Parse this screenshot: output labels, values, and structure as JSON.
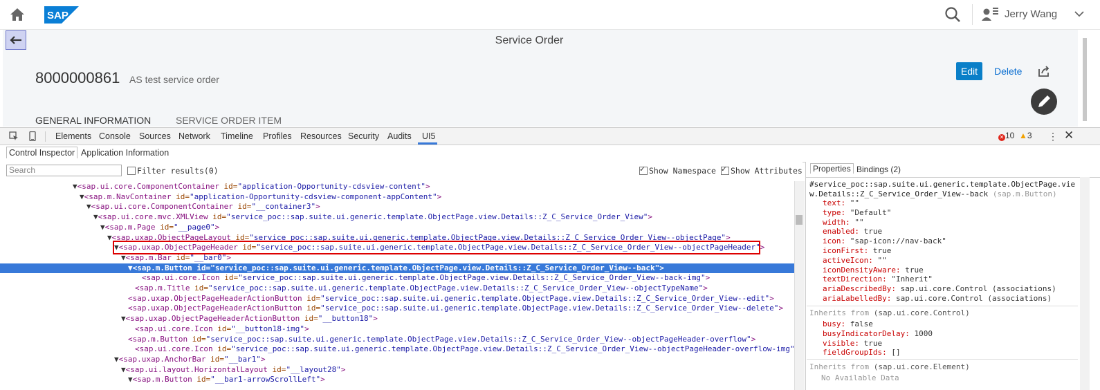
{
  "shell": {
    "user_name": "Jerry Wang",
    "logo_text": "SAP"
  },
  "page": {
    "title": "Service Order",
    "object_id": "8000000861",
    "object_description": "AS test service order",
    "edit_label": "Edit",
    "delete_label": "Delete",
    "tabs": [
      "GENERAL INFORMATION",
      "SERVICE ORDER ITEM"
    ]
  },
  "devtools": {
    "tabs": [
      "Elements",
      "Console",
      "Sources",
      "Network",
      "Timeline",
      "Profiles",
      "Resources",
      "Security",
      "Audits",
      "UI5"
    ],
    "errors": "10",
    "warnings": "3",
    "sub_tabs": [
      "Control Inspector",
      "Application Information"
    ],
    "search_placeholder": "Search",
    "filter_label": "Filter results(0)",
    "show_namespace": "Show Namespace",
    "show_attributes": "Show Attributes"
  },
  "tree": [
    {
      "indent": 105,
      "tri": "▼",
      "tag": "<sap.ui.core.ComponentContainer",
      "attr": " id=",
      "val": "\"application-Opportunity-cdsview-content\"",
      "end": ">"
    },
    {
      "indent": 115,
      "tri": "▼",
      "tag": "<sap.m.NavContainer",
      "attr": " id=",
      "val": "\"application-Opportunity-cdsview-component-appContent\"",
      "end": ">"
    },
    {
      "indent": 125,
      "tri": "▼",
      "tag": "<sap.ui.core.ComponentContainer",
      "attr": " id=",
      "val": "\"__container3\"",
      "end": ">"
    },
    {
      "indent": 135,
      "tri": "▼",
      "tag": "<sap.ui.core.mvc.XMLView",
      "attr": " id=",
      "val": "\"service_poc::sap.suite.ui.generic.template.ObjectPage.view.Details::Z_C_Service_Order_View\"",
      "end": ">"
    },
    {
      "indent": 145,
      "tri": "▼",
      "tag": "<sap.m.Page",
      "attr": " id=",
      "val": "\"__page0\"",
      "end": ">"
    },
    {
      "indent": 155,
      "tri": "▼",
      "tag": "<sap.uxap.ObjectPageLayout",
      "attr": " id=",
      "val": "\"service_poc::sap.suite.ui.generic.template.ObjectPage.view.Details::Z_C_Service_Order_View--objectPage\"",
      "end": ">"
    },
    {
      "indent": 165,
      "tri": "▼",
      "tag": "<sap.uxap.ObjectPageHeader",
      "attr": " id=",
      "val": "\"service_poc::sap.suite.ui.generic.template.ObjectPage.view.Details::Z_C_Service_Order_View--objectPageHeader\"",
      "end": ">"
    },
    {
      "indent": 175,
      "tri": "▼",
      "tag": "<sap.m.Bar",
      "attr": " id=",
      "val": "\"__bar0\"",
      "end": ">"
    },
    {
      "indent": 185,
      "tri": "▼",
      "tag": "<sap.m.Button",
      "attr": " id=",
      "val": "\"service_poc::sap.suite.ui.generic.template.ObjectPage.view.Details::Z_C_Service_Order_View--back\"",
      "end": ">",
      "selected": true
    },
    {
      "indent": 205,
      "tri": "",
      "tag": "<sap.ui.core.Icon",
      "attr": " id=",
      "val": "\"service_poc::sap.suite.ui.generic.template.ObjectPage.view.Details::Z_C_Service_Order_View--back-img\"",
      "end": ">"
    },
    {
      "indent": 195,
      "tri": "",
      "tag": "<sap.m.Title",
      "attr": " id=",
      "val": "\"service_poc::sap.suite.ui.generic.template.ObjectPage.view.Details::Z_C_Service_Order_View--objectTypeName\"",
      "end": ">"
    },
    {
      "indent": 185,
      "tri": "",
      "tag": "<sap.uxap.ObjectPageHeaderActionButton",
      "attr": " id=",
      "val": "\"service_poc::sap.suite.ui.generic.template.ObjectPage.view.Details::Z_C_Service_Order_View--edit\"",
      "end": ">"
    },
    {
      "indent": 185,
      "tri": "",
      "tag": "<sap.uxap.ObjectPageHeaderActionButton",
      "attr": " id=",
      "val": "\"service_poc::sap.suite.ui.generic.template.ObjectPage.view.Details::Z_C_Service_Order_View--delete\"",
      "end": ">"
    },
    {
      "indent": 175,
      "tri": "▼",
      "tag": "<sap.uxap.ObjectPageHeaderActionButton",
      "attr": " id=",
      "val": "\"__button18\"",
      "end": ">"
    },
    {
      "indent": 195,
      "tri": "",
      "tag": "<sap.ui.core.Icon",
      "attr": " id=",
      "val": "\"__button18-img\"",
      "end": ">"
    },
    {
      "indent": 185,
      "tri": "",
      "tag": "<sap.m.Button",
      "attr": " id=",
      "val": "\"service_poc::sap.suite.ui.generic.template.ObjectPage.view.Details::Z_C_Service_Order_View--objectPageHeader-overflow\"",
      "end": ">"
    },
    {
      "indent": 195,
      "tri": "",
      "tag": "<sap.ui.core.Icon",
      "attr": " id=",
      "val": "\"service_poc::sap.suite.ui.generic.template.ObjectPage.view.Details::Z_C_Service_Order_View--objectPageHeader-overflow-img\"",
      "end": ">"
    },
    {
      "indent": 165,
      "tri": "▼",
      "tag": "<sap.uxap.AnchorBar",
      "attr": " id=",
      "val": "\"__bar1\"",
      "end": ">"
    },
    {
      "indent": 175,
      "tri": "▼",
      "tag": "<sap.ui.layout.HorizontalLayout",
      "attr": " id=",
      "val": "\"__layout28\"",
      "end": ">"
    },
    {
      "indent": 185,
      "tri": "▼",
      "tag": "<sap.m.Button",
      "attr": " id=",
      "val": "\"__bar1-arrowScrollLeft\"",
      "end": ">"
    }
  ],
  "properties": {
    "tabs": [
      "Properties",
      "Bindings (2)"
    ],
    "selected_id": "#service_poc::sap.suite.ui.generic.template.ObjectPage.view.Details::Z_C_Service_Order_View--back",
    "selected_type": "(sap.m.Button)",
    "own": [
      {
        "name": "text:",
        "value": " \"\""
      },
      {
        "name": "type:",
        "value": " \"Default\""
      },
      {
        "name": "width:",
        "value": " \"\""
      },
      {
        "name": "enabled:",
        "value": " true"
      },
      {
        "name": "icon:",
        "value": " \"sap-icon://nav-back\""
      },
      {
        "name": "iconFirst:",
        "value": " true"
      },
      {
        "name": "activeIcon:",
        "value": " \"\""
      },
      {
        "name": "iconDensityAware:",
        "value": " true"
      },
      {
        "name": "textDirection:",
        "value": " \"Inherit\""
      },
      {
        "name": "ariaDescribedBy:",
        "value": " sap.ui.core.Control (associations)"
      },
      {
        "name": "ariaLabelledBy:",
        "value": " sap.ui.core.Control (associations)"
      }
    ],
    "inherits_label": "Inherits from",
    "control_type": "(sap.ui.core.Control)",
    "control": [
      {
        "name": "busy:",
        "value": " false"
      },
      {
        "name": "busyIndicatorDelay:",
        "value": " 1000"
      },
      {
        "name": "visible:",
        "value": " true"
      },
      {
        "name": "fieldGroupIds:",
        "value": " []"
      }
    ],
    "element_type": "(sap.ui.core.Element)",
    "no_data": "No Available Data"
  }
}
